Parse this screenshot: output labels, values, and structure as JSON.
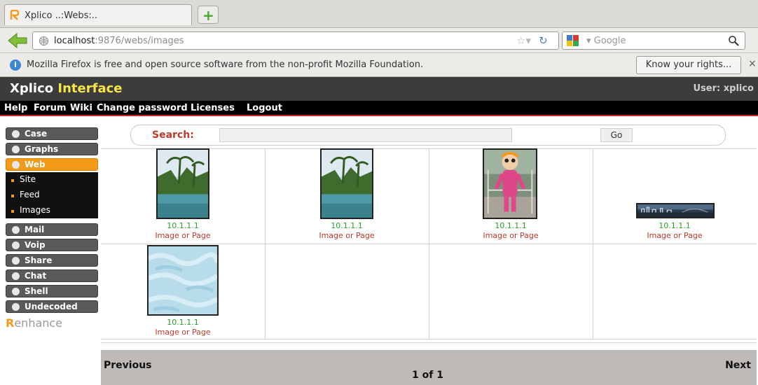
{
  "browser": {
    "tab_title": "Xplico ..:Webs:..",
    "url_host": "localhost",
    "url_rest": ":9876/webs/images",
    "search_placeholder": "Google",
    "notification": "Mozilla Firefox is free and open source software from the non-profit Mozilla Foundation.",
    "rights_button": "Know your rights...",
    "close_glyph": "×"
  },
  "header": {
    "logo_part1": "Xplico",
    "logo_part2": "Interface",
    "user": "User: xplico"
  },
  "topmenu": [
    "Help",
    "Forum",
    "Wiki",
    "Change password",
    "Licenses",
    "Logout"
  ],
  "sidebar": {
    "items_top": [
      {
        "label": "Case",
        "active": false
      },
      {
        "label": "Graphs",
        "active": false
      },
      {
        "label": "Web",
        "active": true
      }
    ],
    "web_sub": [
      "Site",
      "Feed",
      "Images"
    ],
    "items_bottom": [
      "Mail",
      "Voip",
      "Share",
      "Chat",
      "Shell",
      "Undecoded"
    ],
    "enhance_prefix": "R",
    "enhance_label": "enhance"
  },
  "search": {
    "label": "Search:",
    "value": "",
    "go_label": "Go"
  },
  "images": [
    {
      "ip": "10.1.1.1",
      "link": "Image or Page",
      "thumb": "palm-beach"
    },
    {
      "ip": "10.1.1.1",
      "link": "Image or Page",
      "thumb": "palm-beach"
    },
    {
      "ip": "10.1.1.1",
      "link": "Image or Page",
      "thumb": "mascot"
    },
    {
      "ip": "10.1.1.1",
      "link": "Image or Page",
      "thumb": "skyline"
    },
    {
      "ip": "10.1.1.1",
      "link": "Image or Page",
      "thumb": "sky-texture"
    }
  ],
  "paging": {
    "previous": "Previous",
    "page": "1 of 1",
    "next": "Next"
  },
  "colors": {
    "accent_orange": "#f39a18",
    "header_dark": "#3c3c3c",
    "menu_red_rule": "#c22a1c",
    "ip_green": "#27a027",
    "link_red": "#c0392b"
  }
}
